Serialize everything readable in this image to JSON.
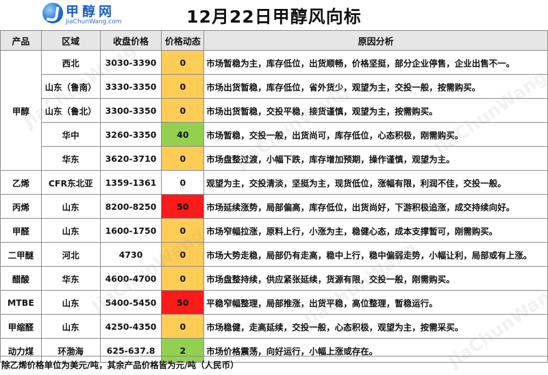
{
  "logo": {
    "cn": "甲醇网",
    "en": "JiaChunWang.com"
  },
  "title": "12月22日甲醇风向标",
  "columns": [
    "产品",
    "区域",
    "收盘价格",
    "价格动态",
    "原因分析"
  ],
  "rows": [
    {
      "product": "甲醇",
      "region": "西北",
      "price": "3030-3390",
      "change": "0",
      "level": "flat",
      "reason": "市场暂稳为主，库存低位，出货顺畅，价格坚挺，部分企业停售，企业出售不一。"
    },
    {
      "product": "",
      "region": "山东（鲁南）",
      "price": "3330-3350",
      "change": "0",
      "level": "flat",
      "reason": "市场出货暂稳，库存低位，省外货少，观望为主，交投一般，按需购买。"
    },
    {
      "product": "",
      "region": "山东（鲁北）",
      "price": "3300-3350",
      "change": "0",
      "level": "flat",
      "reason": "市场出货暂稳，交投平稳，接货谨慎，观望为主，按需购买。"
    },
    {
      "product": "",
      "region": "华中",
      "price": "3260-3350",
      "change": "40",
      "level": "up",
      "reason": "市场暂稳，交投一般，出货尚可，库存低位，心态积极，刚需购买。"
    },
    {
      "product": "",
      "region": "华东",
      "price": "3620-3710",
      "change": "0",
      "level": "flat",
      "reason": "市场盘整过渡，小幅下跌，库存增加预期，操作谨慎，观望为主。"
    },
    {
      "product": "乙烯",
      "region": "CFR东北亚",
      "price": "1359-1361",
      "change": "0",
      "level": "none",
      "reason": "观望为主，交投清淡，坚挺为主，现货低位，涨幅有限，利润不佳，交投一般。"
    },
    {
      "product": "丙烯",
      "region": "山东",
      "price": "8200-8250",
      "change": "50",
      "level": "hot",
      "reason": "市场延续涨势，局部偏高，库存低位，出货尚好，下游积极追涨，成交持续向好。"
    },
    {
      "product": "甲醛",
      "region": "山东",
      "price": "1600-1750",
      "change": "0",
      "level": "flat",
      "reason": "市场窄幅拉涨，原料上行，小涨为主，稳健心态，成本支撑暂可，刚需购买。"
    },
    {
      "product": "二甲醚",
      "region": "河北",
      "price": "4730",
      "change": "0",
      "level": "flat",
      "reason": "市场大势走稳，局部仍有走高，稳中上行，稳中偏弱走势，小幅让利，局部或有上涨。"
    },
    {
      "product": "醋酸",
      "region": "华东",
      "price": "4600-4700",
      "change": "0",
      "level": "flat",
      "reason": "市场盘整持续，供应紧张延续，货源有限，交投一般，刚需购买。"
    },
    {
      "product": "MTBE",
      "region": "山东",
      "price": "5400-5450",
      "change": "50",
      "level": "hot",
      "reason": "平稳窄幅整理，局部推涨，出货平稳，高位整理，暂稳运行。"
    },
    {
      "product": "甲缩醛",
      "region": "山东",
      "price": "4250-4350",
      "change": "0",
      "level": "flat",
      "reason": "市场稳健，走高延续，交投一般，心态积极，观望为主，按需采买。"
    },
    {
      "product": "动力煤",
      "region": "环渤海",
      "price": "625-637.8",
      "change": "2",
      "level": "up",
      "reason": " 市场价格震荡，向好运行，小幅上涨或存在。"
    }
  ],
  "footnote": "除乙烯价格单位为美元/吨，其余产品价格皆为元/吨（人民币）",
  "colors": {
    "flat": "#ffcc55",
    "up": "#92d050",
    "hot": "#ff1a1a",
    "header_bg": "#e6e6e6"
  }
}
